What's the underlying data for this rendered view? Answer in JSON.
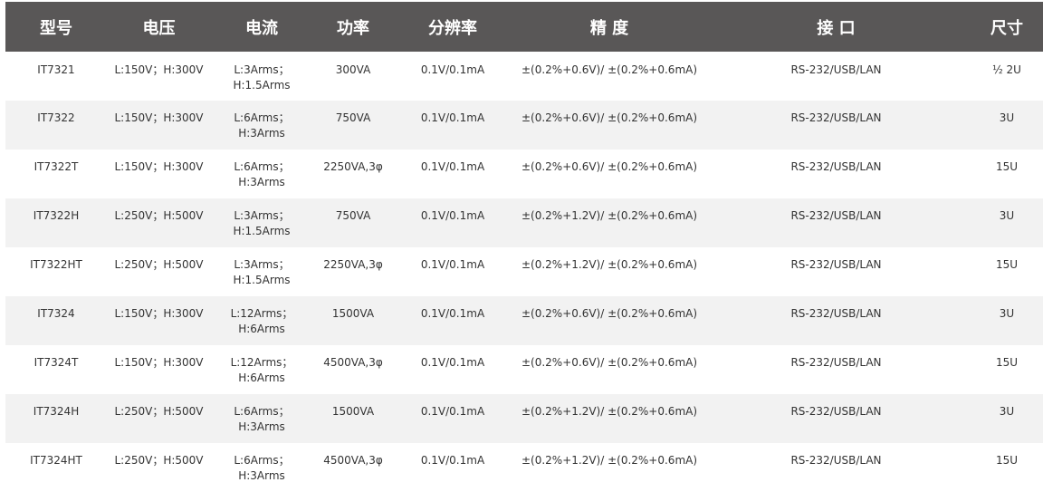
{
  "table": {
    "headers": [
      "型号",
      "电压",
      "电流",
      "功率",
      "分辨率",
      "精 度",
      "接 口",
      "尺寸"
    ],
    "rows": [
      {
        "model": "IT7321",
        "voltage": "L:150V；H:300V",
        "current": [
          "L:3Arms；",
          "H:1.5Arms"
        ],
        "power": "300VA",
        "resolution": "0.1V/0.1mA",
        "accuracy": "±(0.2%+0.6V)/ ±(0.2%+0.6mA)",
        "interface": "RS-232/USB/LAN",
        "size": "½ 2U"
      },
      {
        "model": "IT7322",
        "voltage": "L:150V；H:300V",
        "current": [
          "L:6Arms；",
          "H:3Arms"
        ],
        "power": "750VA",
        "resolution": "0.1V/0.1mA",
        "accuracy": "±(0.2%+0.6V)/ ±(0.2%+0.6mA)",
        "interface": "RS-232/USB/LAN",
        "size": "3U"
      },
      {
        "model": "IT7322T",
        "voltage": "L:150V；H:300V",
        "current": [
          "L:6Arms；",
          "H:3Arms"
        ],
        "power": "2250VA,3φ",
        "resolution": "0.1V/0.1mA",
        "accuracy": "±(0.2%+0.6V)/ ±(0.2%+0.6mA)",
        "interface": "RS-232/USB/LAN",
        "size": "15U"
      },
      {
        "model": "IT7322H",
        "voltage": "L:250V；H:500V",
        "current": [
          "L:3Arms；",
          "H:1.5Arms"
        ],
        "power": "750VA",
        "resolution": "0.1V/0.1mA",
        "accuracy": "±(0.2%+1.2V)/ ±(0.2%+0.6mA)",
        "interface": "RS-232/USB/LAN",
        "size": "3U"
      },
      {
        "model": "IT7322HT",
        "voltage": "L:250V；H:500V",
        "current": [
          "L:3Arms；",
          "H:1.5Arms"
        ],
        "power": "2250VA,3φ",
        "resolution": "0.1V/0.1mA",
        "accuracy": "±(0.2%+1.2V)/ ±(0.2%+0.6mA)",
        "interface": "RS-232/USB/LAN",
        "size": "15U"
      },
      {
        "model": "IT7324",
        "voltage": "L:150V；H:300V",
        "current": [
          "L:12Arms；",
          "H:6Arms"
        ],
        "power": "1500VA",
        "resolution": "0.1V/0.1mA",
        "accuracy": "±(0.2%+0.6V)/ ±(0.2%+0.6mA)",
        "interface": "RS-232/USB/LAN",
        "size": "3U"
      },
      {
        "model": "IT7324T",
        "voltage": "L:150V；H:300V",
        "current": [
          "L:12Arms；",
          "H:6Arms"
        ],
        "power": "4500VA,3φ",
        "resolution": "0.1V/0.1mA",
        "accuracy": "±(0.2%+0.6V)/ ±(0.2%+0.6mA)",
        "interface": "RS-232/USB/LAN",
        "size": "15U"
      },
      {
        "model": "IT7324H",
        "voltage": "L:250V；H:500V",
        "current": [
          "L:6Arms；",
          "H:3Arms"
        ],
        "power": "1500VA",
        "resolution": "0.1V/0.1mA",
        "accuracy": "±(0.2%+1.2V)/ ±(0.2%+0.6mA)",
        "interface": "RS-232/USB/LAN",
        "size": "3U"
      },
      {
        "model": "IT7324HT",
        "voltage": "L:250V；H:500V",
        "current": [
          "L:6Arms；",
          "H:3Arms"
        ],
        "power": "4500VA,3φ",
        "resolution": "0.1V/0.1mA",
        "accuracy": "±(0.2%+1.2V)/ ±(0.2%+0.6mA)",
        "interface": "RS-232/USB/LAN",
        "size": "15U"
      }
    ]
  },
  "colors": {
    "header_bg": "#595757",
    "header_text": "#ffffff",
    "row_alt_bg": "#f2f2f2",
    "cell_text": "#333333"
  }
}
